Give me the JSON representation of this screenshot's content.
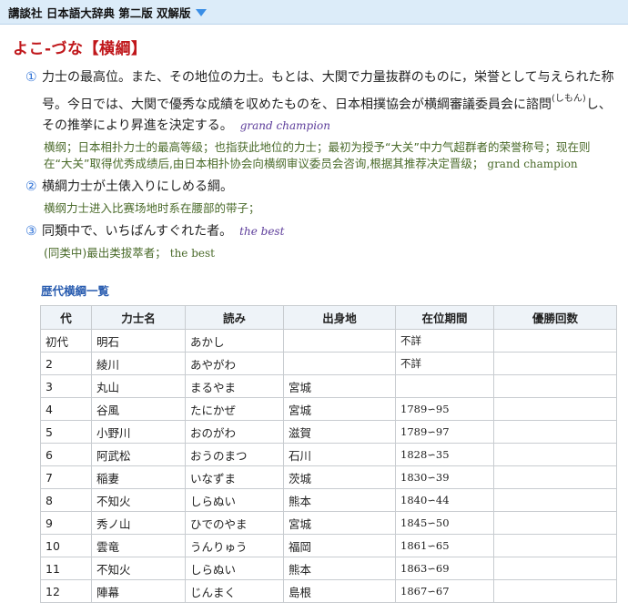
{
  "header": {
    "dictionary": "講談社 日本語大辞典 第二版 双解版"
  },
  "entry": {
    "headword": "よこ-づな【横綱】",
    "senses": [
      {
        "num": "①",
        "text_before": "力士の最高位。また、その地位の力士。もとは、大関で力量抜群のものに，栄誉として与えられた称号。今日では、大関で優秀な成績を収めたものを、日本相撲協会が横綱審議委員会に諮問",
        "ruby": "(しもん)",
        "text_after": "し、その推挙により昇進を決定する。",
        "en": "grand champion",
        "cn": "横纲；日本相扑力士的最高等级；也指获此地位的力士；最初为授予“大关”中力气超群者的荣誉称号；现在则在“大关”取得优秀成绩后,由日本相扑协会向横纲审议委员会咨询,根据其推荐决定晋级；",
        "cn_en": "grand champion"
      },
      {
        "num": "②",
        "text": "横綱力士が土俵入りにしめる綱。",
        "cn": "横纲力士进入比赛场地时系在腰部的带子；"
      },
      {
        "num": "③",
        "text": "同類中で、いちばんすぐれた者。",
        "en": "the best",
        "cn": "(同类中)最出类拔萃者；",
        "cn_en": "the best"
      }
    ]
  },
  "table": {
    "title": "歴代横綱一覧",
    "headers": [
      "代",
      "力士名",
      "読み",
      "出身地",
      "在位期間",
      "優勝回数"
    ],
    "rows": [
      [
        "初代",
        "明石",
        "あかし",
        "",
        "不詳",
        ""
      ],
      [
        "2",
        "綾川",
        "あやがわ",
        "",
        "不詳",
        ""
      ],
      [
        "3",
        "丸山",
        "まるやま",
        "宮城",
        "",
        ""
      ],
      [
        "4",
        "谷風",
        "たにかぜ",
        "宮城",
        "1789∽95",
        ""
      ],
      [
        "5",
        "小野川",
        "おのがわ",
        "滋賀",
        "1789∽97",
        ""
      ],
      [
        "6",
        "阿武松",
        "おうのまつ",
        "石川",
        "1828∽35",
        ""
      ],
      [
        "7",
        "稲妻",
        "いなずま",
        "茨城",
        "1830∽39",
        ""
      ],
      [
        "8",
        "不知火",
        "しらぬい",
        "熊本",
        "1840∽44",
        ""
      ],
      [
        "9",
        "秀ノ山",
        "ひでのやま",
        "宮城",
        "1845∽50",
        ""
      ],
      [
        "10",
        "雲竜",
        "うんりゅう",
        "福岡",
        "1861∽65",
        ""
      ],
      [
        "11",
        "不知火",
        "しらぬい",
        "熊本",
        "1863∽69",
        ""
      ],
      [
        "12",
        "陣幕",
        "じんまく",
        "島根",
        "1867∽67",
        ""
      ]
    ]
  }
}
